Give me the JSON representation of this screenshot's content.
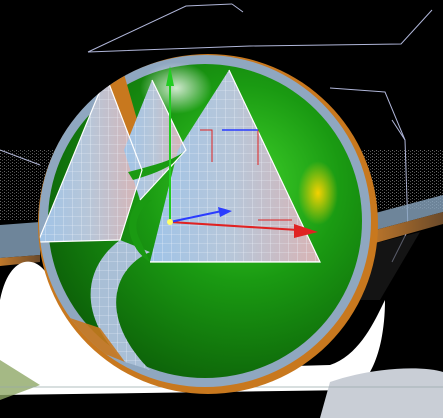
{
  "viewport": {
    "background": "#000000",
    "colors": {
      "sphere": "#1a9a12",
      "sphere_rim": "#8fa7c0",
      "sphere_edge": "#c8781e",
      "floor_glow": "#ffffff",
      "wire": "#e6eef7",
      "axis_x": "#e02222",
      "axis_y": "#22cc22",
      "axis_z": "#2a3cff",
      "bounding_box": "#cfd6ff"
    },
    "icons": [
      "sphere-object",
      "wireframe-logo-mesh",
      "transform-gizmo",
      "floor-plane",
      "camera-frustum-lines"
    ]
  }
}
